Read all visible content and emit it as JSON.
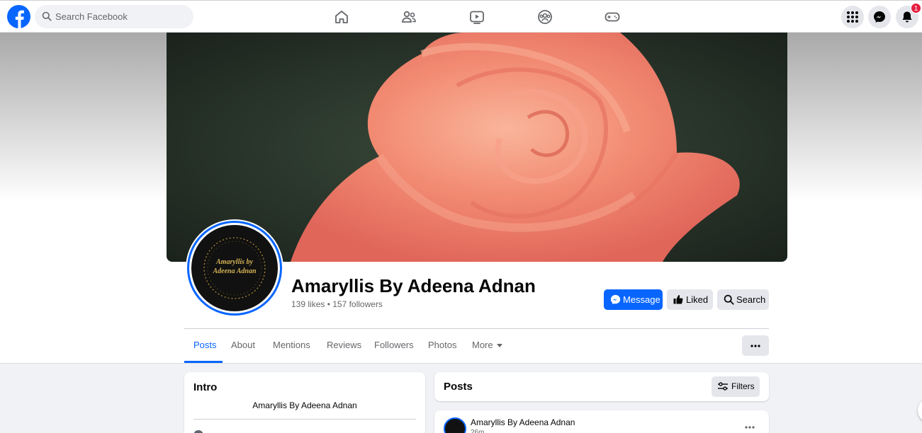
{
  "topbar": {
    "search_placeholder": "Search Facebook",
    "notification_count": "1",
    "nav_icons": [
      "home-icon",
      "friends-icon",
      "watch-icon",
      "groups-icon",
      "gaming-icon"
    ],
    "right_icons": [
      "menu-grid-icon",
      "messenger-icon",
      "notifications-bell-icon"
    ]
  },
  "profile": {
    "name": "Amaryllis By Adeena Adnan",
    "stats": "139 likes • 157 followers",
    "avatar_text_line1": "Amaryllis by",
    "avatar_text_line2": "Adeena Adnan"
  },
  "actions": {
    "message_label": "Message",
    "liked_label": "Liked",
    "search_label": "Search"
  },
  "tabs": [
    {
      "label": "Posts",
      "active": true
    },
    {
      "label": "About"
    },
    {
      "label": "Mentions"
    },
    {
      "label": "Reviews"
    },
    {
      "label": "Followers"
    },
    {
      "label": "Photos"
    },
    {
      "label": "More"
    }
  ],
  "intro": {
    "title": "Intro",
    "bio": "Amaryllis By Adeena Adnan"
  },
  "posts": {
    "title": "Posts",
    "filters_label": "Filters",
    "first_post_author": "Amaryllis By Adeena Adnan",
    "first_post_time": "26m"
  },
  "colors": {
    "brand_blue": "#0866ff",
    "notification_red": "#e41e3f",
    "cover_rose": "#f28a72"
  }
}
